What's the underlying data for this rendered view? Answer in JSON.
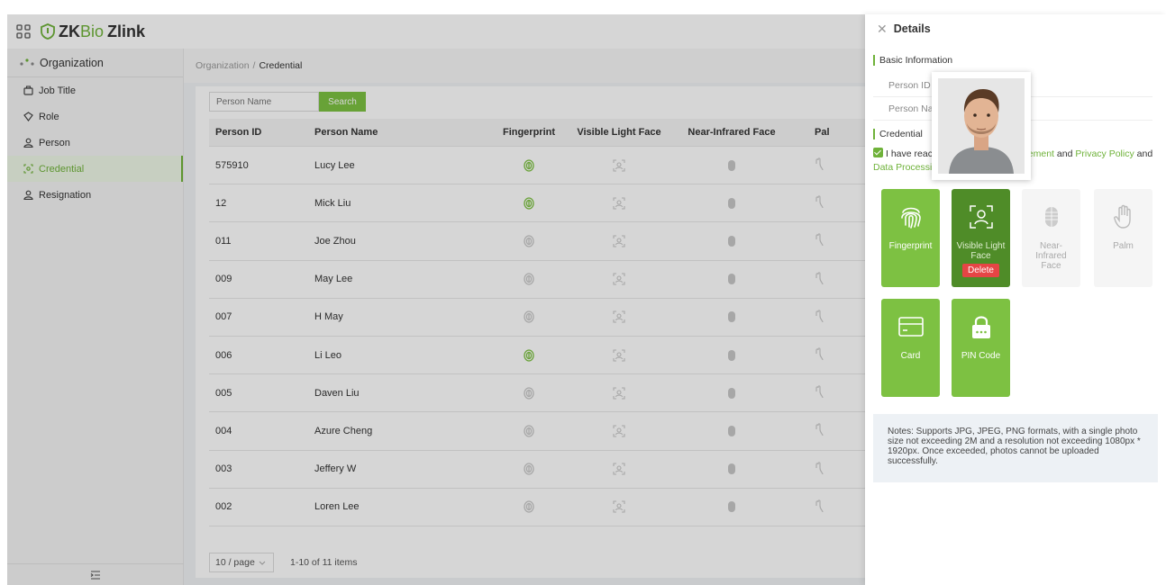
{
  "app": {
    "logo_zk": "ZK",
    "logo_bio": "Bio",
    "logo_zlink": "Zlink"
  },
  "sidebar": {
    "section": "Organization",
    "items": [
      {
        "label": "Job Title",
        "icon": "briefcase-icon"
      },
      {
        "label": "Role",
        "icon": "role-icon"
      },
      {
        "label": "Person",
        "icon": "person-icon"
      },
      {
        "label": "Credential",
        "icon": "credential-icon",
        "active": true
      },
      {
        "label": "Resignation",
        "icon": "person-icon"
      }
    ]
  },
  "breadcrumb": {
    "root": "Organization",
    "sep": "/",
    "current": "Credential"
  },
  "search": {
    "placeholder": "Person Name",
    "button": "Search"
  },
  "table": {
    "headers": [
      "Person ID",
      "Person Name",
      "Fingerprint",
      "Visible Light Face",
      "Near-Infrared Face",
      "Pal"
    ],
    "rows": [
      {
        "id": "575910",
        "name": "Lucy Lee",
        "fingerprint": true
      },
      {
        "id": "12",
        "name": "Mick Liu",
        "fingerprint": true
      },
      {
        "id": "011",
        "name": "Joe Zhou",
        "fingerprint": false
      },
      {
        "id": "009",
        "name": "May Lee",
        "fingerprint": false
      },
      {
        "id": "007",
        "name": "H May",
        "fingerprint": false
      },
      {
        "id": "006",
        "name": "Li Leo",
        "fingerprint": true
      },
      {
        "id": "005",
        "name": "Daven Liu",
        "fingerprint": false
      },
      {
        "id": "004",
        "name": "Azure Cheng",
        "fingerprint": false
      },
      {
        "id": "003",
        "name": "Jeffery W",
        "fingerprint": false
      },
      {
        "id": "002",
        "name": "Loren Lee",
        "fingerprint": false
      }
    ]
  },
  "pager": {
    "page_size": "10 / page",
    "summary": "1-10 of 11 items"
  },
  "drawer": {
    "title": "Details",
    "basic_info": "Basic Information",
    "person_id_label": "Person ID",
    "person_name_label": "Person Na",
    "credential": "Credential",
    "agree_prefix": "I have reac",
    "agree_link1": "ement",
    "agree_and": "and",
    "agree_link2": "Privacy Policy",
    "agree_and2": "and",
    "agree_link3": "Data Processi",
    "tiles": {
      "fingerprint": "Fingerprint",
      "visible_face": "Visible Light Face",
      "delete": "Delete",
      "near_infrared": "Near-Infrared Face",
      "palm": "Palm",
      "card": "Card",
      "pin": "PIN Code"
    },
    "notes": "Notes: Supports JPG, JPEG, PNG formats, with a single photo size not exceeding 2M and a resolution not exceeding 1080px * 1920px. Once exceeded, photos cannot be uploaded successfully."
  },
  "colors": {
    "accent": "#7dc142",
    "accent_dark": "#4f8c28",
    "danger": "#e64545"
  }
}
